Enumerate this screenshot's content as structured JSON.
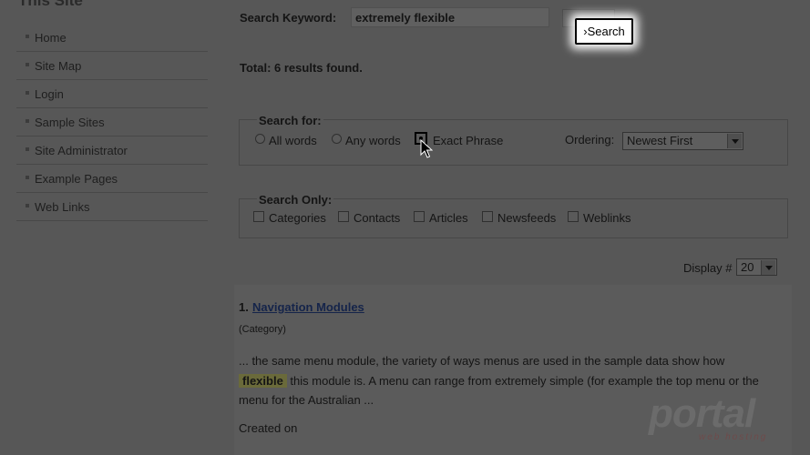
{
  "sidebar": {
    "title": "This Site",
    "items": [
      {
        "label": "Home"
      },
      {
        "label": "Site Map"
      },
      {
        "label": "Login"
      },
      {
        "label": "Sample Sites"
      },
      {
        "label": "Site Administrator"
      },
      {
        "label": "Example Pages"
      },
      {
        "label": "Web Links"
      }
    ]
  },
  "search": {
    "keyword_label": "Search Keyword:",
    "keyword_value": "extremely flexible",
    "button_label": "Search",
    "button_highlight_prefix": "›",
    "total": "Total: 6 results found."
  },
  "search_for": {
    "legend": "Search for:",
    "options": [
      {
        "label": "All words",
        "checked": false
      },
      {
        "label": "Any words",
        "checked": false
      },
      {
        "label": "Exact Phrase",
        "checked": true
      }
    ],
    "ordering_label": "Ordering:",
    "ordering_value": "Newest First"
  },
  "search_only": {
    "legend": "Search Only:",
    "options": [
      {
        "label": "Categories"
      },
      {
        "label": "Contacts"
      },
      {
        "label": "Articles"
      },
      {
        "label": "Newsfeeds"
      },
      {
        "label": "Weblinks"
      }
    ]
  },
  "display": {
    "label": "Display #",
    "value": "20"
  },
  "result": {
    "number": "1.",
    "title": "Navigation Modules",
    "category": "(Category)",
    "text_before": "... the same menu module, the variety of ways menus are used in the sample data show how",
    "highlight": "flexible",
    "text_after": "this module is. A menu can range from extremely simple (for example the top menu or the menu for the Australian ...",
    "created": "Created on"
  },
  "watermark": {
    "brand": "portal",
    "tagline": "web hosting"
  }
}
